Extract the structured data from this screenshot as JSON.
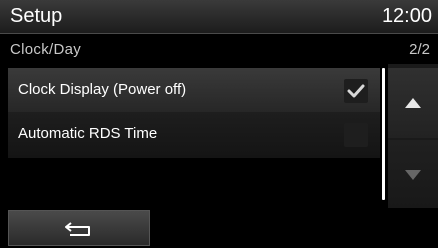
{
  "header": {
    "title": "Setup",
    "time": "12:00"
  },
  "subheader": {
    "section": "Clock/Day",
    "page_indicator": "2/2"
  },
  "list": {
    "items": [
      {
        "label": "Clock Display (Power off)",
        "checked": true
      },
      {
        "label": "Automatic RDS Time",
        "checked": false
      }
    ]
  },
  "scroll": {
    "up_icon": "triangle-up",
    "down_icon": "triangle-down"
  },
  "footer": {
    "back_icon": "return-arrow"
  },
  "colors": {
    "background": "#000000",
    "text": "#ffffff",
    "secondary_text": "#c8c8c8",
    "check": "#d8d8d8"
  }
}
